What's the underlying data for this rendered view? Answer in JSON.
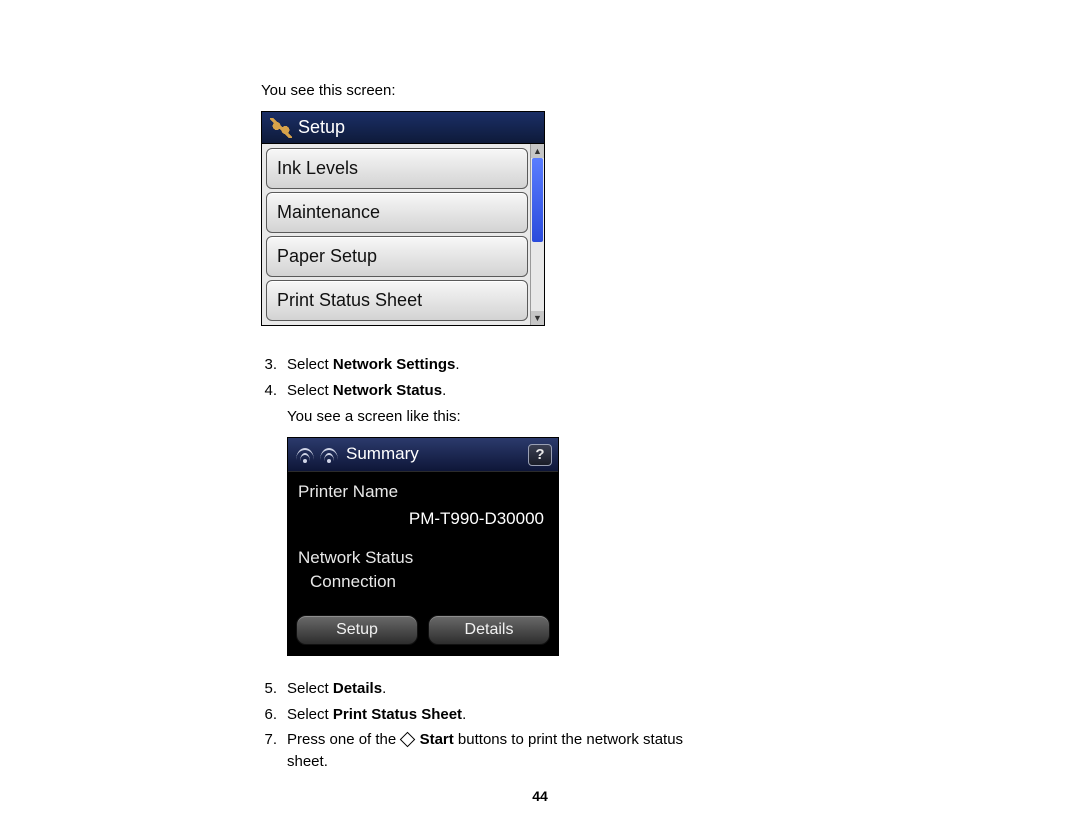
{
  "intro": "You see this screen:",
  "screenshot1": {
    "title": "Setup",
    "items": [
      "Ink Levels",
      "Maintenance",
      "Paper Setup",
      "Print Status Sheet"
    ]
  },
  "steps_a": [
    {
      "n": "3.",
      "prefix": "Select ",
      "bold": "Network Settings",
      "suffix": "."
    },
    {
      "n": "4.",
      "prefix": "Select ",
      "bold": "Network Status",
      "suffix": "."
    }
  ],
  "after4": "You see a screen like this:",
  "screenshot2": {
    "title": "Summary",
    "printer_name_label": "Printer Name",
    "printer_name_value": "PM-T990-D30000",
    "network_status_label": "Network Status",
    "connection_label": "Connection",
    "buttons": {
      "setup": "Setup",
      "details": "Details"
    },
    "help": "?"
  },
  "steps_b": [
    {
      "n": "5.",
      "prefix": "Select ",
      "bold": "Details",
      "suffix": "."
    },
    {
      "n": "6.",
      "prefix": "Select ",
      "bold": "Print Status Sheet",
      "suffix": "."
    }
  ],
  "step7": {
    "n": "7.",
    "prefix": "Press one of the ",
    "bold": "Start",
    "suffix": " buttons to print the network status sheet."
  },
  "page_number": "44"
}
